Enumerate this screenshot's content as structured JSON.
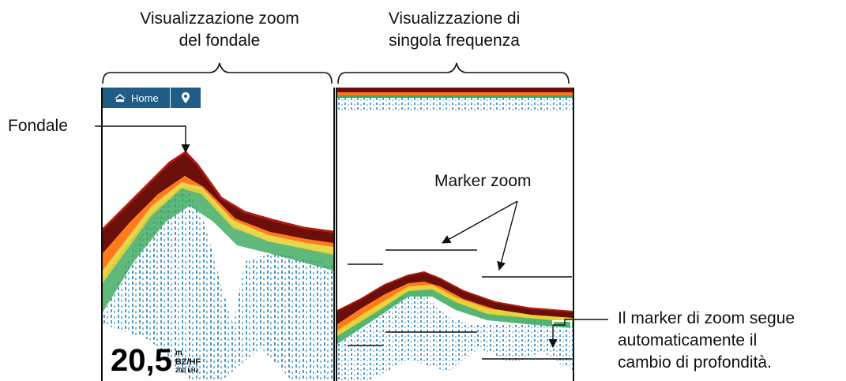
{
  "captions": {
    "zoom_view": [
      "Visualizzazione zoom",
      "del fondale"
    ],
    "single_view": [
      "Visualizzazione di",
      "singola frequenza"
    ]
  },
  "toolbar": {
    "home_label": "Home",
    "home_icon": "home-icon",
    "pin_icon": "location-pin-icon",
    "bg_color": "#1f5c86"
  },
  "depth_readout": {
    "value": "20,5",
    "unit": "m",
    "mode": "BZ/HF",
    "frequency": "200 kHz"
  },
  "callouts": {
    "seabed": "Fondale",
    "zoom_marker": "Marker zoom",
    "follow": [
      "Il marker di zoom segue",
      "automaticamente il",
      "cambio di profondità."
    ]
  },
  "colors": {
    "seabed_dark": "#6b0f0a",
    "seabed_red": "#b01a10",
    "orange": "#ff7a1a",
    "yellow": "#e8d23a",
    "green": "#38a85a",
    "blue": "#3a8fc4"
  }
}
